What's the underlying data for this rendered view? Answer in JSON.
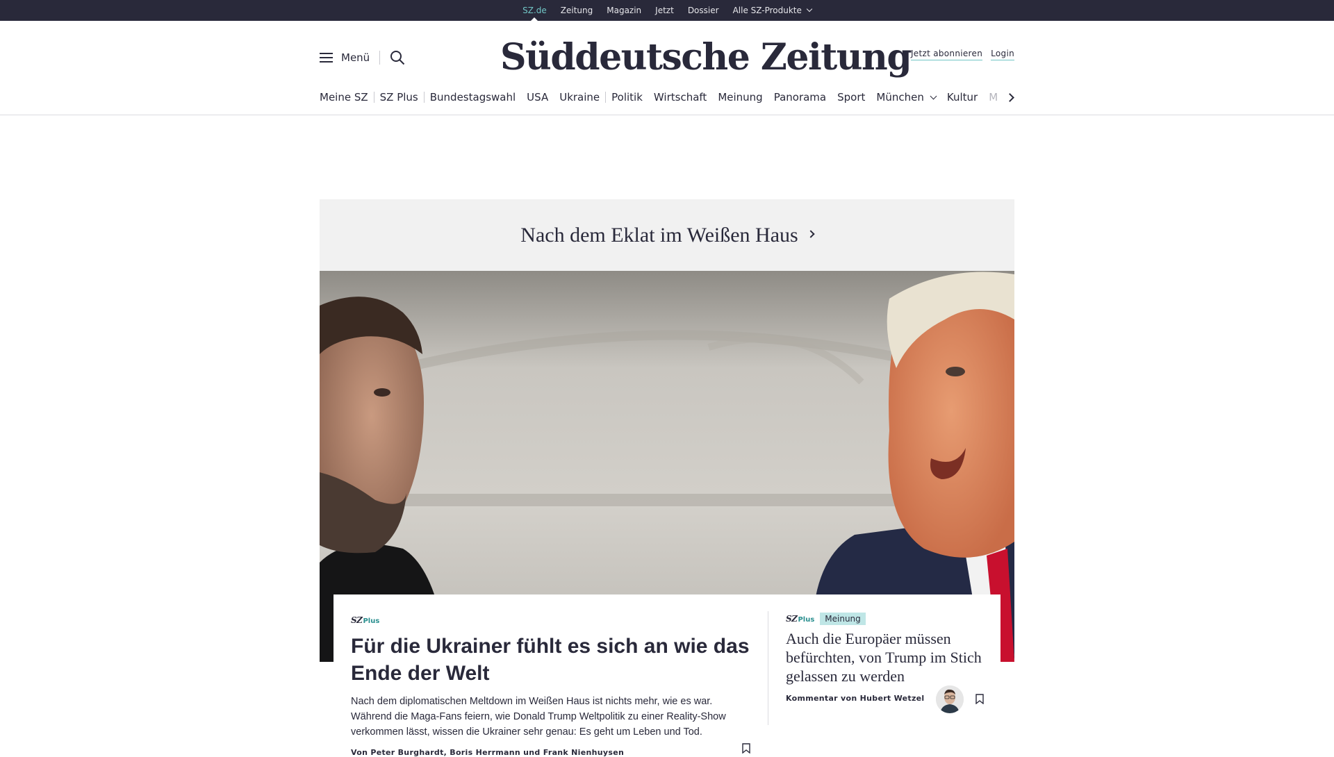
{
  "topbar": {
    "items": [
      "SZ.de",
      "Zeitung",
      "Magazin",
      "Jetzt",
      "Dossier",
      "Alle SZ-Produkte"
    ]
  },
  "header": {
    "menu_label": "Menü",
    "logo": "Süddeutsche Zeitung",
    "subscribe": "Jetzt abonnieren",
    "login": "Login"
  },
  "nav": {
    "items": [
      "Meine SZ",
      "SZ Plus",
      "Bundestagswahl",
      "USA",
      "Ukraine",
      "Politik",
      "Wirtschaft",
      "Meinung",
      "Panorama",
      "Sport",
      "München",
      "Kultur",
      "M"
    ]
  },
  "topic": {
    "title": "Nach dem Eklat im Weißen Haus"
  },
  "main_teaser": {
    "brand": "SZ",
    "plus": "Plus",
    "headline": "Für die Ukrainer fühlt es sich an wie das Ende der Welt",
    "summary": "Nach dem diplomatischen Meltdown im Weißen Haus ist nichts mehr, wie es war. Während die Maga-Fans feiern, wie Donald Trump Weltpolitik zu einer Reality-Show verkommen lässt, wissen die Ukrainer sehr genau: Es geht um Leben und Tod.",
    "author": "Von Peter Burghardt, Boris Herrmann und Frank Nienhuysen"
  },
  "side_teaser": {
    "brand": "SZ",
    "plus": "Plus",
    "badge": "Meinung",
    "headline": "Auch die Europäer müssen befürchten, von Trump im Stich gelassen zu werden",
    "author": "Kommentar von Hubert Wetzel"
  },
  "icons": {
    "menu": "hamburger-icon",
    "search": "search-icon",
    "bookmark": "bookmark-icon",
    "chevron": "chevron-icon"
  },
  "colors": {
    "dark": "#29293a",
    "accent": "#71c5c5",
    "badge": "#bfe6e6",
    "topic_bg": "#f1f1f1"
  }
}
